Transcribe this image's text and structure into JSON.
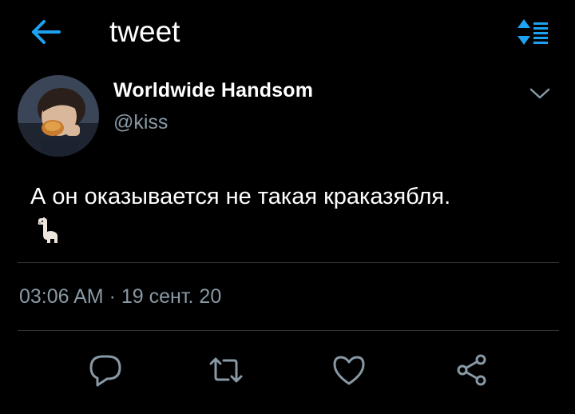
{
  "header": {
    "title": "tweet",
    "back_icon": "arrow-left-icon",
    "sort_icon": "sort-order-icon",
    "accent_color": "#1da1f2"
  },
  "author": {
    "name": "Worldwide Handsom",
    "handle": "@kiss",
    "avatar": "avatar-photo",
    "more_icon": "chevron-down-icon"
  },
  "tweet": {
    "text": "А он оказывается не такая краказябля.",
    "emoji": "llama-emoji"
  },
  "meta": {
    "time": "03:06 AM",
    "separator": "·",
    "date": "19 сент. 20"
  },
  "actions": [
    {
      "icon": "reply-icon"
    },
    {
      "icon": "retweet-icon"
    },
    {
      "icon": "like-icon"
    },
    {
      "icon": "share-icon"
    }
  ],
  "colors": {
    "background": "#000000",
    "text_primary": "#ffffff",
    "text_secondary": "#8899a6",
    "divider": "#2f3336"
  }
}
